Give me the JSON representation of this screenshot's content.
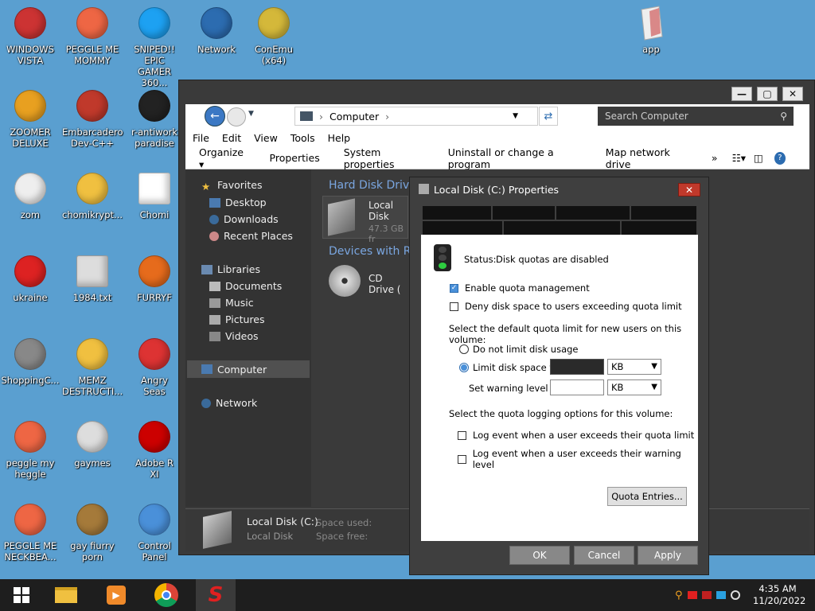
{
  "desktop": {
    "icons_left": [
      {
        "label": "WINDOWS\nVISTA",
        "icon": "vista-icon"
      },
      {
        "label": "PEGGLE ME\nMOMMY",
        "icon": "peggle-icon"
      },
      {
        "label": "SNIPED!! EPIC\nGAMER 360...",
        "icon": "skype-icon"
      },
      {
        "label": "Network",
        "icon": "network-globe-icon"
      },
      {
        "label": "ConEmu (x64)",
        "icon": "conemu-icon"
      },
      {
        "label": "ZOOMER\nDELUXE",
        "icon": "zoomer-icon"
      },
      {
        "label": "Embarcadero\nDev-C++",
        "icon": "devcpp-icon"
      },
      {
        "label": "r-antiwork\nparadise",
        "icon": "antiwork-icon"
      },
      {
        "label": "zom",
        "icon": "flower-icon"
      },
      {
        "label": "chomikrypt...",
        "icon": "clock-l-icon"
      },
      {
        "label": "Chomi",
        "icon": "window-icon"
      },
      {
        "label": "ukraine",
        "icon": "radiation-icon"
      },
      {
        "label": "1984.txt",
        "icon": "text-file-icon"
      },
      {
        "label": "FURRYF",
        "icon": "firefox-icon"
      },
      {
        "label": "ShoppingC...",
        "icon": "flash-icon"
      },
      {
        "label": "MEMZ\nDESTRUCTI...",
        "icon": "clock-l-icon"
      },
      {
        "label": "Angry\nSeas",
        "icon": "angry-birds-icon"
      },
      {
        "label": "peggle my\nheggle",
        "icon": "peggle-icon"
      },
      {
        "label": "gaymes",
        "icon": "folder-icon"
      },
      {
        "label": "Adobe R\nXI",
        "icon": "adobe-reader-icon"
      },
      {
        "label": "PEGGLE ME\nNECKBEA...",
        "icon": "peggle-icon"
      },
      {
        "label": "gay fiurry\nporn",
        "icon": "gopher-box-icon"
      },
      {
        "label": "Control Panel",
        "icon": "control-panel-icon"
      }
    ],
    "icon_app": {
      "label": "app",
      "icon": "paper-bag-icon"
    }
  },
  "explorer": {
    "title_buttons": {
      "minimize": "—",
      "maximize": "▢",
      "close": "✕"
    },
    "address": {
      "root": "Computer",
      "sep": "›"
    },
    "search_placeholder": "Search Computer",
    "menu": [
      "File",
      "Edit",
      "View",
      "Tools",
      "Help"
    ],
    "toolbar": [
      "Organize ▾",
      "Properties",
      "System properties",
      "Uninstall or change a program",
      "Map network drive",
      "»"
    ],
    "nav": {
      "favorites": "Favorites",
      "fav_items": [
        "Desktop",
        "Downloads",
        "Recent Places"
      ],
      "libraries": "Libraries",
      "lib_items": [
        "Documents",
        "Music",
        "Pictures",
        "Videos"
      ],
      "computer": "Computer",
      "network": "Network"
    },
    "content": {
      "hdd_header": "Hard Disk Drive",
      "local_disk": "Local Disk",
      "local_disk_free": "47.3 GB fr",
      "devices_header": "Devices with Re",
      "cd_drive": "CD Drive ("
    },
    "details": {
      "name": "Local Disk (C:)",
      "type": "Local Disk",
      "space_used": "Space used:",
      "space_free": "Space free:"
    }
  },
  "dialog": {
    "title": "Local Disk (C:) Properties",
    "close": "✕",
    "status_label": "Status:",
    "status_value": "Disk quotas are disabled",
    "enable_quota": "Enable quota management",
    "deny_space": "Deny disk space to users exceeding quota limit",
    "default_limit_text": "Select the default quota limit for new users on this volume:",
    "no_limit": "Do not limit disk usage",
    "limit_to": "Limit disk space to",
    "warning_level": "Set warning level to",
    "unit1": "KB",
    "unit2": "KB",
    "logging_text": "Select the quota logging options for this volume:",
    "log_exceed": "Log event when a user exceeds their quota limit",
    "log_warning": "Log event when a user exceeds their warning level",
    "quota_entries": "Quota Entries...",
    "ok": "OK",
    "cancel": "Cancel",
    "apply": "Apply",
    "enable_checked": true,
    "limit_selected": true
  },
  "taskbar": {
    "time": "4:35 AM",
    "date": "11/20/2022"
  },
  "colors": {
    "accent": "#4a90d9",
    "desktop": "#5a9fd0",
    "dark_window": "#3a3a3a"
  }
}
